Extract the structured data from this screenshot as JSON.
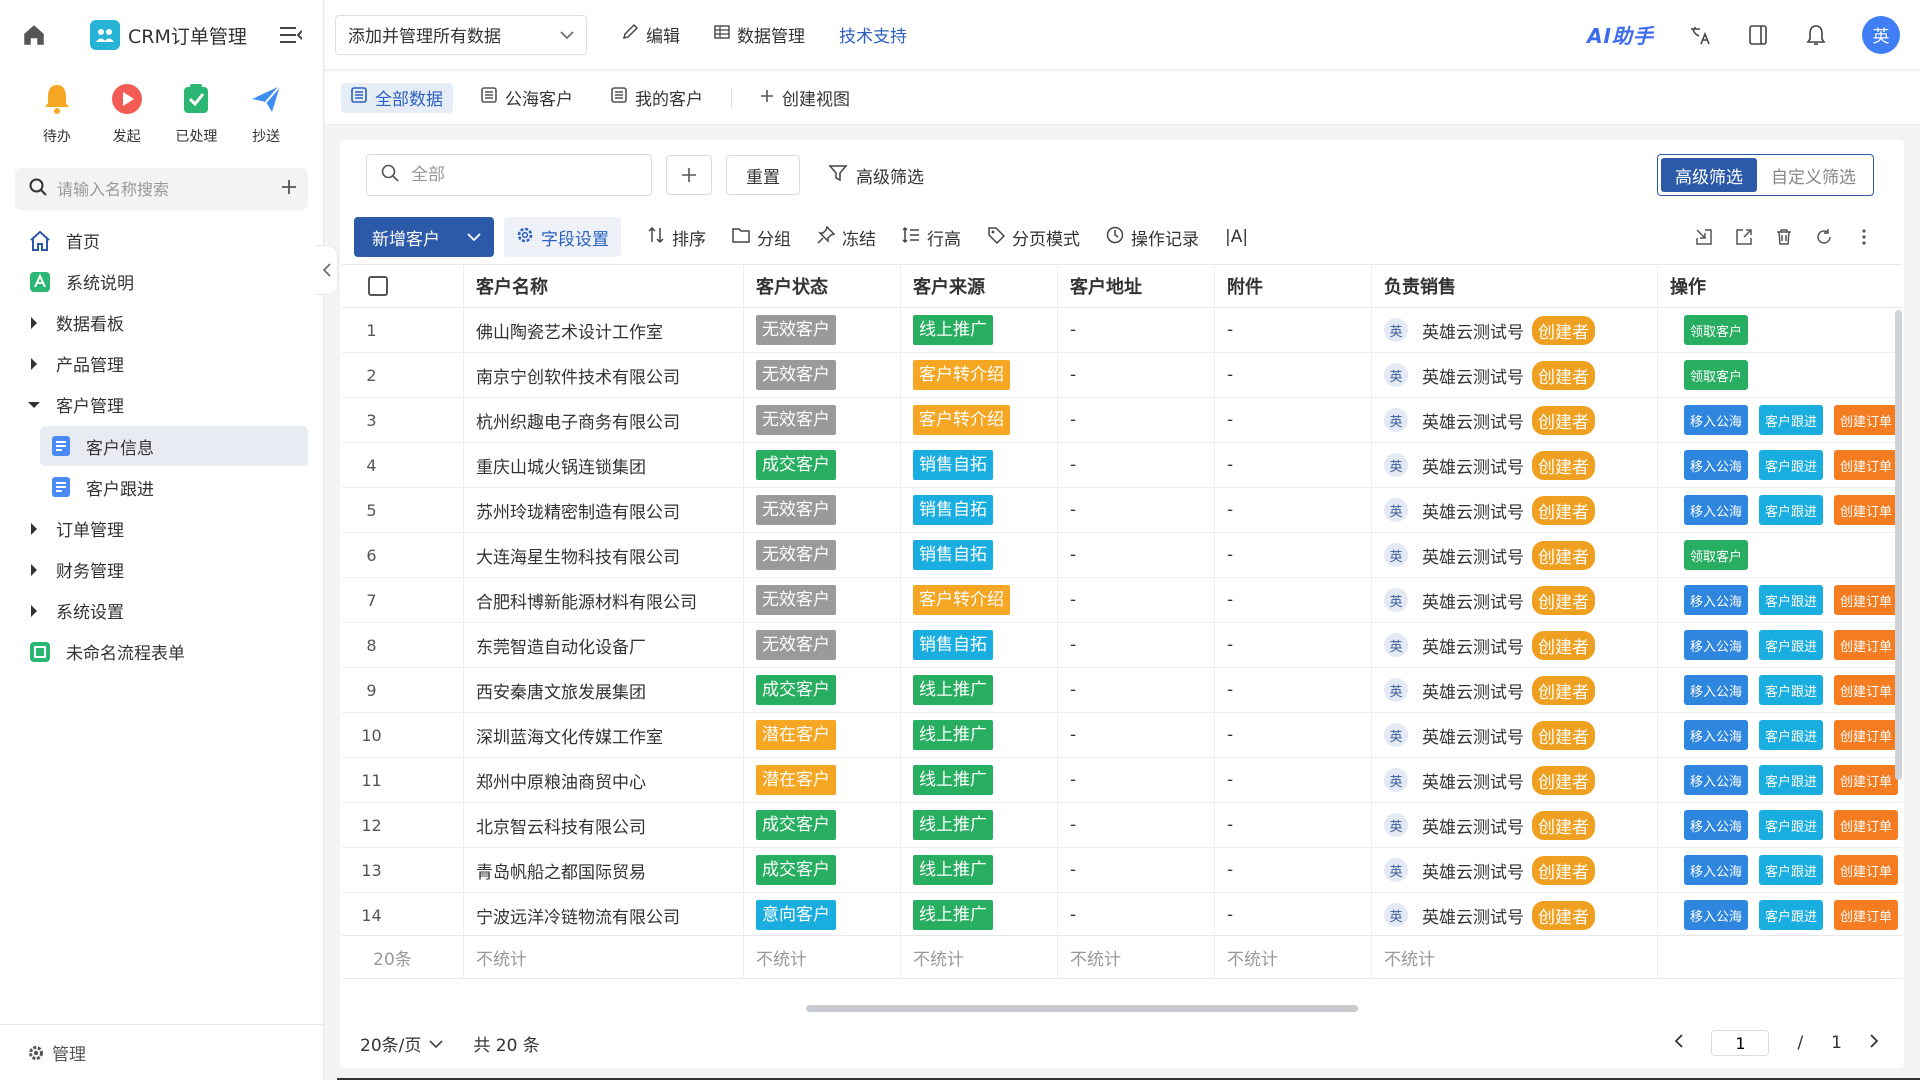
{
  "app": {
    "title": "CRM订单管理"
  },
  "quick_actions": [
    {
      "label": "待办",
      "icon": "bell-icon",
      "color": "#f5a623"
    },
    {
      "label": "发起",
      "icon": "play-icon",
      "color": "#f25c54"
    },
    {
      "label": "已处理",
      "icon": "check-doc-icon",
      "color": "#2bb673"
    },
    {
      "label": "抄送",
      "icon": "send-icon",
      "color": "#3d8ef0"
    }
  ],
  "sidebar": {
    "search_placeholder": "请输入名称搜索",
    "items": [
      {
        "label": "首页"
      },
      {
        "label": "系统说明"
      },
      {
        "label": "数据看板"
      },
      {
        "label": "产品管理"
      },
      {
        "label": "客户管理"
      },
      {
        "label": "客户信息"
      },
      {
        "label": "客户跟进"
      },
      {
        "label": "订单管理"
      },
      {
        "label": "财务管理"
      },
      {
        "label": "系统设置"
      },
      {
        "label": "未命名流程表单"
      }
    ],
    "bottom_label": "管理"
  },
  "topbar": {
    "dataset": "添加并管理所有数据",
    "edit": "编辑",
    "data_mgmt": "数据管理",
    "support": "技术支持",
    "ai": "AI助手",
    "avatar": "英"
  },
  "view_tabs": [
    {
      "label": "全部数据",
      "active": true
    },
    {
      "label": "公海客户"
    },
    {
      "label": "我的客户"
    },
    {
      "label": "创建视图"
    }
  ],
  "filter": {
    "search_placeholder": "全部",
    "reset": "重置",
    "advanced": "高级筛选",
    "seg_advanced": "高级筛选",
    "seg_custom": "自定义筛选"
  },
  "toolbar": {
    "new_customer": "新增客户",
    "field_settings": "字段设置",
    "sort": "排序",
    "group": "分组",
    "freeze": "冻结",
    "row_height": "行高",
    "paging_mode": "分页模式",
    "op_log": "操作记录",
    "font": "|A|"
  },
  "table": {
    "columns": [
      "客户名称",
      "客户状态",
      "客户来源",
      "客户地址",
      "附件",
      "负责销售",
      "操作"
    ],
    "status_colors": {
      "无效客户": "#9a9a9a",
      "成交客户": "#27ae60",
      "潜在客户": "#f5a623",
      "意向客户": "#1aaee0"
    },
    "source_colors": {
      "线上推广": "#27ae60",
      "客户转介绍": "#f5a623",
      "销售自拓": "#1aaee0"
    },
    "sales_name": "英雄云测试号",
    "sales_avatar": "英",
    "creator_tag": "创建者",
    "op_labels": {
      "claim": "领取客户",
      "move": "移入公海",
      "follow": "客户跟进",
      "order": "创建订单"
    },
    "rows": [
      {
        "idx": "1",
        "name": "佛山陶瓷艺术设计工作室",
        "status": "无效客户",
        "source": "线上推广",
        "address": "-",
        "attachment": "-",
        "ops": [
          "claim"
        ]
      },
      {
        "idx": "2",
        "name": "南京宁创软件技术有限公司",
        "status": "无效客户",
        "source": "客户转介绍",
        "address": "-",
        "attachment": "-",
        "ops": [
          "claim"
        ]
      },
      {
        "idx": "3",
        "name": "杭州织趣电子商务有限公司",
        "status": "无效客户",
        "source": "客户转介绍",
        "address": "-",
        "attachment": "-",
        "ops": [
          "move",
          "follow",
          "order"
        ]
      },
      {
        "idx": "4",
        "name": "重庆山城火锅连锁集团",
        "status": "成交客户",
        "source": "销售自拓",
        "address": "-",
        "attachment": "-",
        "ops": [
          "move",
          "follow",
          "order"
        ]
      },
      {
        "idx": "5",
        "name": "苏州玲珑精密制造有限公司",
        "status": "无效客户",
        "source": "销售自拓",
        "address": "-",
        "attachment": "-",
        "ops": [
          "move",
          "follow",
          "order"
        ]
      },
      {
        "idx": "6",
        "name": "大连海星生物科技有限公司",
        "status": "无效客户",
        "source": "销售自拓",
        "address": "-",
        "attachment": "-",
        "ops": [
          "claim"
        ]
      },
      {
        "idx": "7",
        "name": "合肥科博新能源材料有限公司",
        "status": "无效客户",
        "source": "客户转介绍",
        "address": "-",
        "attachment": "-",
        "ops": [
          "move",
          "follow",
          "order"
        ]
      },
      {
        "idx": "8",
        "name": "东莞智造自动化设备厂",
        "status": "无效客户",
        "source": "销售自拓",
        "address": "-",
        "attachment": "-",
        "ops": [
          "move",
          "follow",
          "order"
        ]
      },
      {
        "idx": "9",
        "name": "西安秦唐文旅发展集团",
        "status": "成交客户",
        "source": "线上推广",
        "address": "-",
        "attachment": "-",
        "ops": [
          "move",
          "follow",
          "order"
        ]
      },
      {
        "idx": "10",
        "name": "深圳蓝海文化传媒工作室",
        "status": "潜在客户",
        "source": "线上推广",
        "address": "-",
        "attachment": "-",
        "ops": [
          "move",
          "follow",
          "order"
        ]
      },
      {
        "idx": "11",
        "name": "郑州中原粮油商贸中心",
        "status": "潜在客户",
        "source": "线上推广",
        "address": "-",
        "attachment": "-",
        "ops": [
          "move",
          "follow",
          "order"
        ]
      },
      {
        "idx": "12",
        "name": "北京智云科技有限公司",
        "status": "成交客户",
        "source": "线上推广",
        "address": "-",
        "attachment": "-",
        "ops": [
          "move",
          "follow",
          "order"
        ]
      },
      {
        "idx": "13",
        "name": "青岛帆船之都国际贸易",
        "status": "成交客户",
        "source": "线上推广",
        "address": "-",
        "attachment": "-",
        "ops": [
          "move",
          "follow",
          "order"
        ]
      },
      {
        "idx": "14",
        "name": "宁波远洋冷链物流有限公司",
        "status": "意向客户",
        "source": "线上推广",
        "address": "-",
        "attachment": "-",
        "ops": [
          "move",
          "follow",
          "order"
        ]
      }
    ],
    "footer": {
      "count": "20条",
      "stat": "不统计"
    }
  },
  "pager": {
    "page_size": "20条/页",
    "total": "共 20 条",
    "current": "1",
    "slash": "/",
    "pages": "1"
  }
}
